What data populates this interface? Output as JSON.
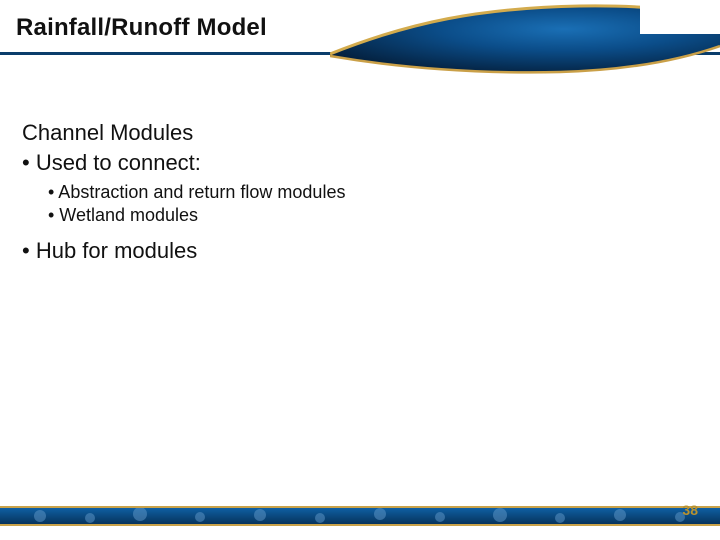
{
  "header": {
    "title": "Rainfall/Runoff Model"
  },
  "content": {
    "subheading": "Channel Modules",
    "bullet1": "• Used to connect:",
    "sub1": "• Abstraction and return flow modules",
    "sub2": "• Wetland modules",
    "bullet2": "• Hub for modules"
  },
  "footer": {
    "page_number": "38"
  }
}
